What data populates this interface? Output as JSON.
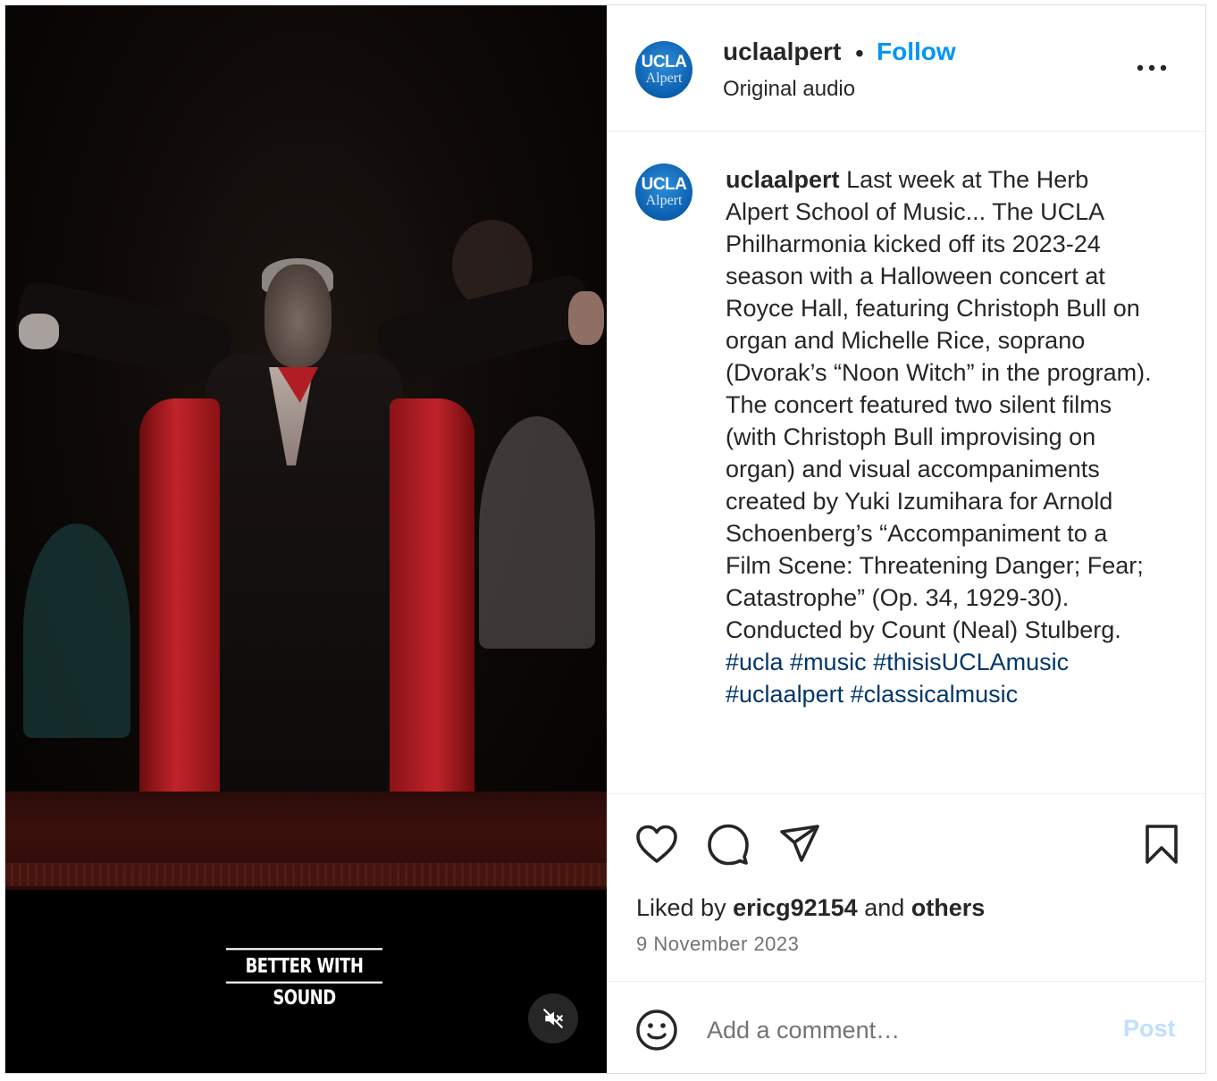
{
  "video": {
    "overlay_text": "BETTER WITH SOUND",
    "mute_icon": "speaker-muted-icon"
  },
  "header": {
    "avatar_line1": "UCLA",
    "avatar_line2": "Alpert",
    "username": "uclaalpert",
    "separator": "•",
    "follow_label": "Follow",
    "audio_label": "Original audio",
    "more_icon": "more-options-icon"
  },
  "caption": {
    "avatar_line1": "UCLA",
    "avatar_line2": "Alpert",
    "username": "uclaalpert",
    "text": " Last week at The Herb Alpert School of Music... The UCLA Philharmonia kicked off its 2023-24 season with a Halloween concert at Royce Hall, featuring Christoph Bull on organ and Michelle Rice, soprano (Dvorak’s “Noon Witch” in the program). The concert featured two silent films (with Christoph Bull improvising on organ) and visual accompaniments created by Yuki Izumihara for Arnold Schoenberg’s “Accompaniment to a Film Scene: Threatening Danger; Fear; Catastrophe” (Op. 34, 1929-30). Conducted by Count (Neal) Stulberg.",
    "hashtags": "#ucla #music #thisisUCLAmusic #uclaalpert #classicalmusic"
  },
  "actions": {
    "like_icon": "heart-icon",
    "comment_icon": "comment-icon",
    "share_icon": "share-icon",
    "save_icon": "bookmark-icon"
  },
  "likes": {
    "prefix": "Liked by ",
    "user": "ericg92154",
    "middle": " and ",
    "others": "others"
  },
  "date": "9 November 2023",
  "comment": {
    "emoji_icon": "emoji-icon",
    "placeholder": "Add a comment…",
    "post_label": "Post"
  },
  "colors": {
    "accent": "#0095f6",
    "hashtag": "#00376b",
    "post_disabled": "#c0dffd",
    "muted_text": "#737373"
  }
}
